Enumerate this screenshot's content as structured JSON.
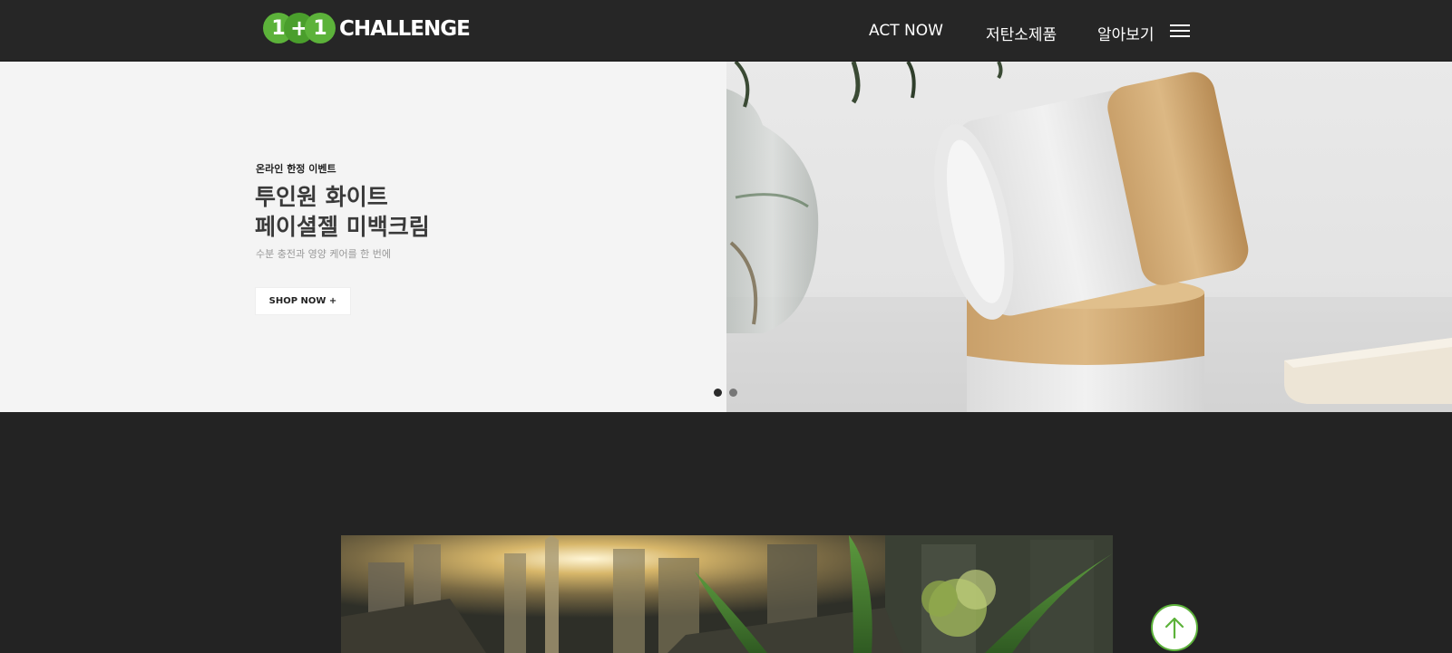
{
  "header": {
    "logo": {
      "digit_left": "1",
      "plus": "+",
      "digit_right": "1",
      "word": "CHALLENGE"
    },
    "nav": {
      "act_now": "ACT NOW",
      "low_carbon": "저탄소제품",
      "learn_more": "알아보기"
    }
  },
  "hero": {
    "eyebrow": "온라인 한정 이벤트",
    "title_line1": "투인원 화이트",
    "title_line2": "페이셜젤 미백크림",
    "subtitle": "수분 충전과 영양 케어를 한 번에",
    "cta": "SHOP NOW +",
    "slides": {
      "count": 2,
      "active_index": 0
    }
  },
  "colors": {
    "header_bg": "#262626",
    "page_bg": "#232323",
    "brand_green": "#5cb23a",
    "hero_left_bg": "#f4f4f4"
  },
  "icons": {
    "menu": "hamburger-icon",
    "scroll_top": "arrow-up-icon"
  }
}
